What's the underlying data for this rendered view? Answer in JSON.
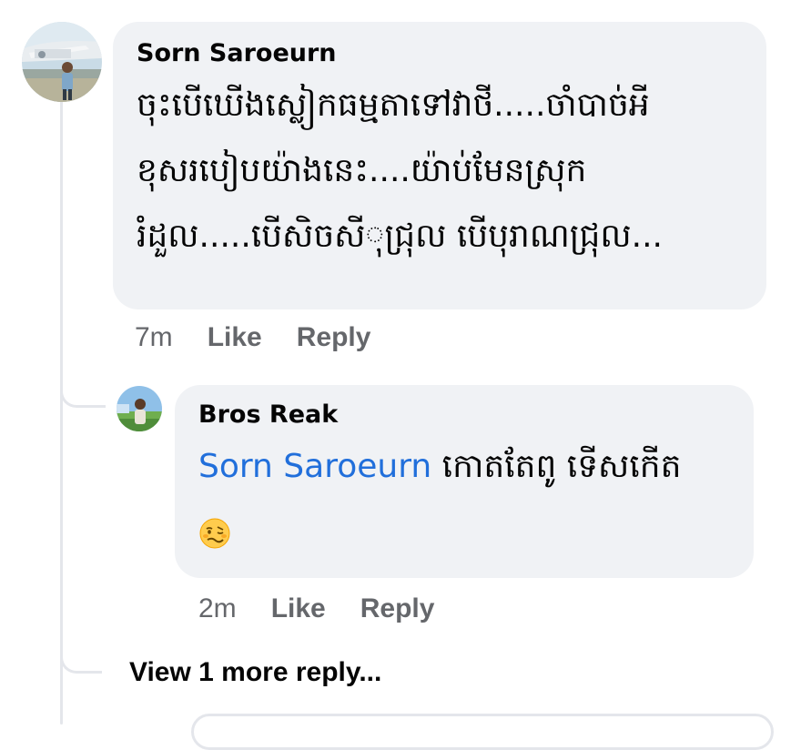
{
  "comment": {
    "author": "Sorn Saroeurn",
    "lines": [
      "ចុះបើឃើងស្លៀកធម្មតាទៅវាថី.....ចាំបាច់អី",
      "ខុសរបៀបយ៉ាងនេះ....យ៉ាប់មែនស្រុក",
      "រំដួល.....បើសិចសីុជ្រុល បើបុរាណជ្រុល..."
    ],
    "time": "7m",
    "like_label": "Like",
    "reply_label": "Reply",
    "avatar_icon": "airport-photo-avatar-icon"
  },
  "reply": {
    "author": "Bros Reak",
    "mention": "Sorn Saroeurn",
    "text": " កោតតែពូ ទើសកើត",
    "emoji_icon": "woozy-face-emoji-icon",
    "time": "2m",
    "like_label": "Like",
    "reply_label": "Reply",
    "avatar_icon": "field-photo-avatar-icon"
  },
  "view_more_label": "View 1 more reply...",
  "colors": {
    "bubble": "#f0f2f5",
    "mention": "#216fdb",
    "meta": "#65676b",
    "thread_line": "#e4e6eb"
  }
}
